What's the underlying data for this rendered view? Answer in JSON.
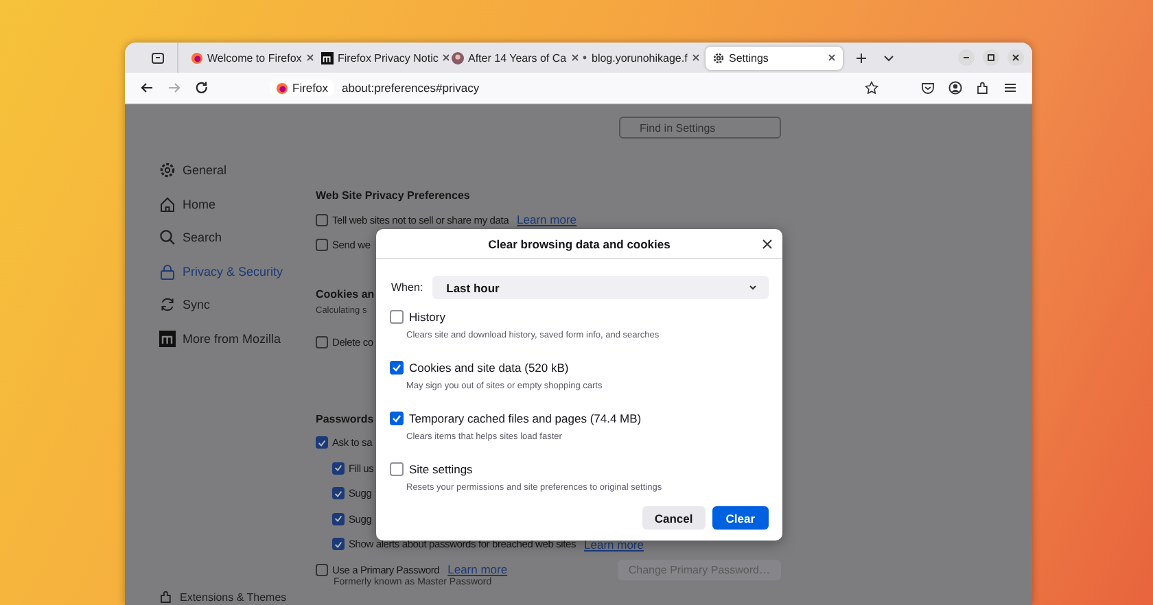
{
  "tabs": [
    {
      "title": "Welcome to Firefox",
      "kind": "firefox",
      "selected": false
    },
    {
      "title": "Firefox Privacy Notic",
      "kind": "mozilla",
      "selected": false
    },
    {
      "title": "After 14 Years of Ca",
      "kind": "avatar",
      "selected": false
    },
    {
      "title": "blog.yorunohikage.f",
      "kind": "dot",
      "selected": false
    },
    {
      "title": "Settings",
      "kind": "gear",
      "selected": true
    }
  ],
  "nav": [
    {
      "kind": "back",
      "disabled": false
    },
    {
      "kind": "forward",
      "disabled": true
    },
    {
      "kind": "reload",
      "disabled": false
    }
  ],
  "address": {
    "identity": "Firefox",
    "url": "about:preferences#privacy"
  },
  "search": {
    "placeholder": "Find in Settings"
  },
  "sidebar": {
    "items": [
      {
        "label": "General",
        "kind": "gear",
        "selected": false
      },
      {
        "label": "Home",
        "kind": "home",
        "selected": false
      },
      {
        "label": "Search",
        "kind": "search",
        "selected": false
      },
      {
        "label": "Privacy & Security",
        "kind": "lock",
        "selected": true
      },
      {
        "label": "Sync",
        "kind": "sync",
        "selected": false
      },
      {
        "label": "More from Mozilla",
        "kind": "mozilla",
        "selected": false
      }
    ],
    "footer": "Extensions & Themes"
  },
  "sections": [
    {
      "heading": "Web Site Privacy Preferences",
      "rows": [
        {
          "label": "Tell web sites not to sell or share my data",
          "link": "Learn more",
          "checked": false
        },
        {
          "label": "Send we",
          "checked": false
        }
      ]
    },
    {
      "heading": "Cookies an",
      "note": "Calculating s",
      "rows": [
        {
          "label": "Delete co",
          "checked": false
        }
      ]
    },
    {
      "heading": "Passwords",
      "rows": [
        {
          "label": "Ask to sa",
          "checked": true,
          "children": [
            {
              "label": "Fill us",
              "checked": true
            },
            {
              "label": "Sugg",
              "checked": true
            },
            {
              "label": "Sugg",
              "checked": true
            },
            {
              "label": "Show alerts about passwords for breached web sites",
              "link": "Learn more",
              "checked": true
            }
          ]
        },
        {
          "label": "Use a Primary Password",
          "link": "Learn more",
          "checked": false,
          "description": "Formerly known as Master Password",
          "button": {
            "label": "Change Primary Password…",
            "disabled": true
          }
        }
      ]
    }
  ],
  "dialog": {
    "title": "Clear browsing data and cookies",
    "when_label": "When:",
    "when_value": "Last hour",
    "options": [
      {
        "label": "History",
        "description": "Clears site and download history, saved form info, and searches",
        "checked": false
      },
      {
        "label": "Cookies and site data (520 kB)",
        "description": "May sign you out of sites or empty shopping carts",
        "checked": true
      },
      {
        "label": "Temporary cached files and pages (74.4 MB)",
        "description": "Clears items that helps sites load faster",
        "checked": true
      },
      {
        "label": "Site settings",
        "description": "Resets your permissions and site preferences to original settings",
        "checked": false
      }
    ],
    "buttons": [
      {
        "label": "Cancel",
        "primary": false
      },
      {
        "label": "Clear",
        "primary": true
      }
    ]
  }
}
